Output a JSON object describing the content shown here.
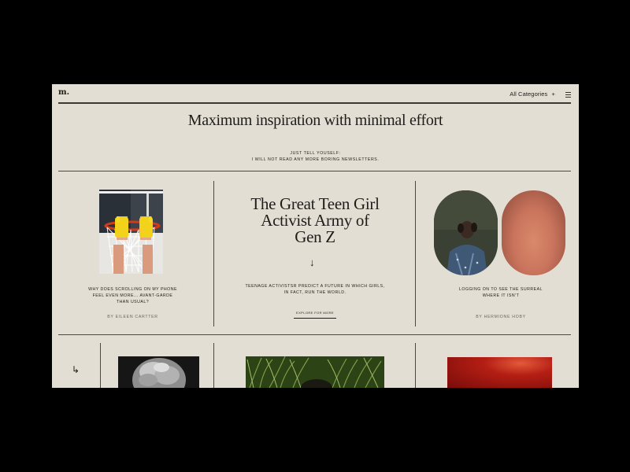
{
  "header": {
    "logo": "m.",
    "categories_label": "All Categories",
    "categories_chevron": "+",
    "menu_icon": "hamburger-icon"
  },
  "hero": {
    "title": "Maximum inspiration with minimal effort",
    "subtitle_line1": "JUST TELL YOUSELF:",
    "subtitle_line2": "I WILL NOT READ ANY MORE BORING NEWSLETTERS."
  },
  "cards": [
    {
      "caption_line1": "WHY DOES SCROLLING ON MY PHONE",
      "caption_line2": "FEEL EVEN MORE... AVANT-GARDE",
      "caption_line3": "THAN USUAL?",
      "byline": "BY EILEEN CARTTER"
    },
    {
      "title_line1": "The Great Teen Girl",
      "title_line2": "Activist Army of",
      "title_line3": "Gen Z",
      "arrow": "↓",
      "desc_line1": "TEENAGE ACTIVISTSR PREDICT A FUTURE IN WHICH GIRLS,",
      "desc_line2": "IN FACT, RUN THE WORLD.",
      "cta": "EXPLORE FOR MORE"
    },
    {
      "caption_line1": "LOGGING ON TO SEE THE SURREAL",
      "caption_line2": "WHERE IT ISN'T",
      "byline": "BY HERMIONE HOBY"
    }
  ],
  "bottom_row": {
    "arrow": "↳"
  }
}
